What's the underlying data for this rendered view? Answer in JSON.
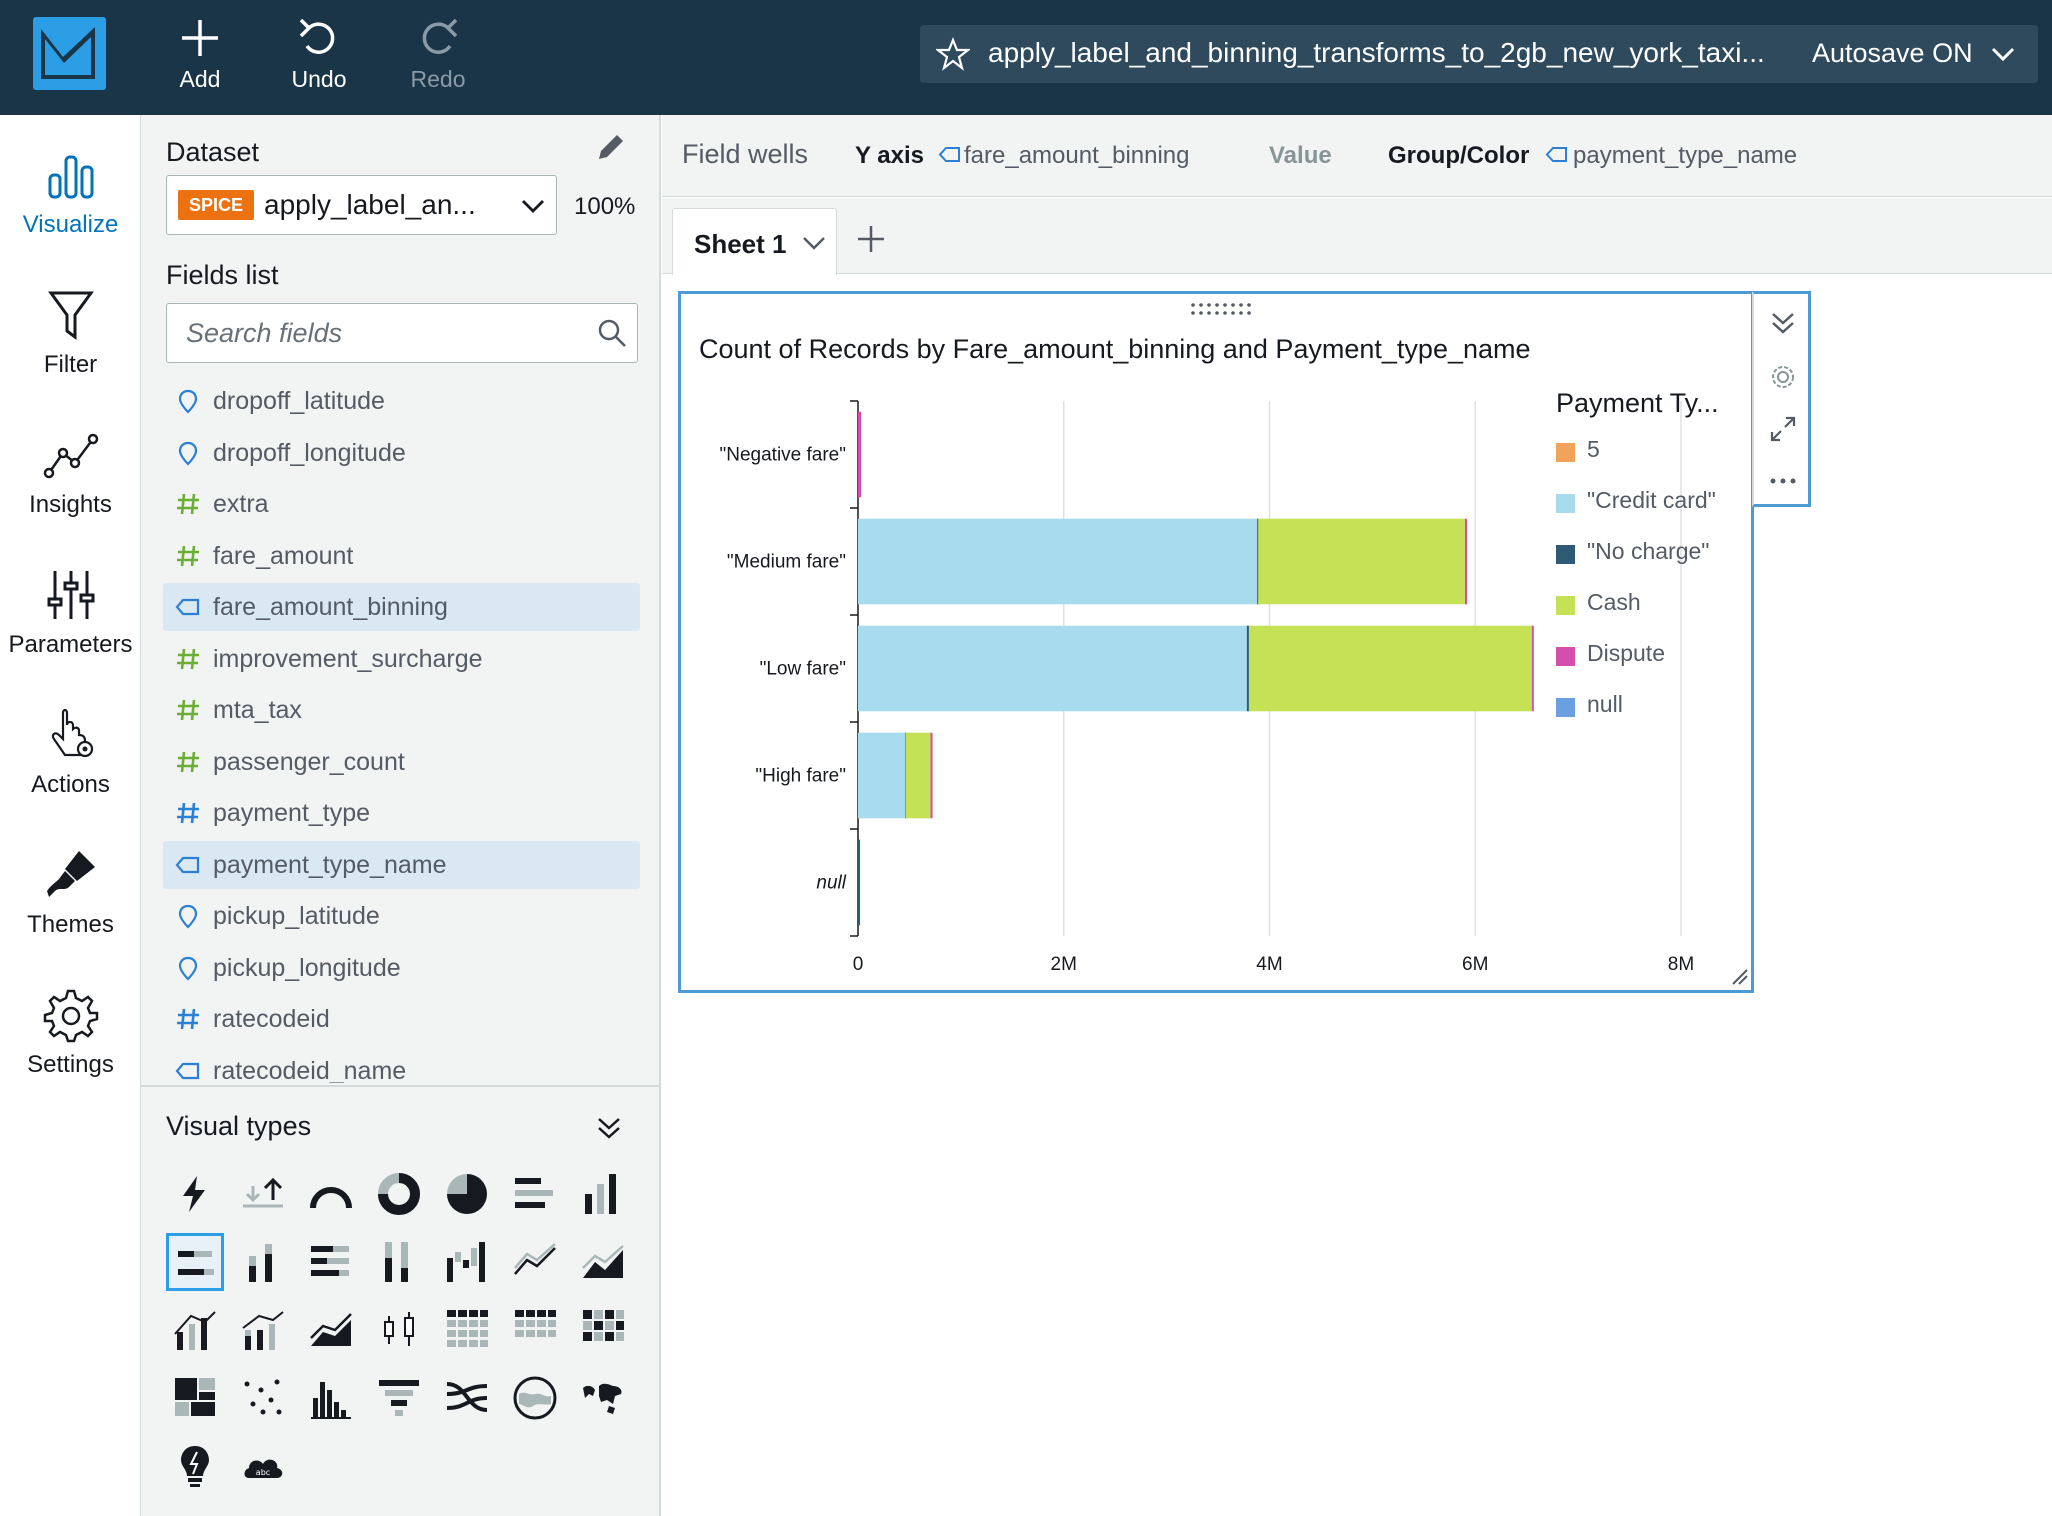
{
  "app": {
    "toolbar": {
      "add_label": "Add",
      "undo_label": "Undo",
      "redo_label": "Redo"
    },
    "analysis_title": "apply_label_and_binning_transforms_to_2gb_new_york_taxi...",
    "autosave_label": "Autosave ON"
  },
  "nav": {
    "items": [
      {
        "label": "Visualize",
        "icon": "bar-chart-icon",
        "active": true
      },
      {
        "label": "Filter",
        "icon": "funnel-icon"
      },
      {
        "label": "Insights",
        "icon": "insights-line-icon"
      },
      {
        "label": "Parameters",
        "icon": "sliders-icon"
      },
      {
        "label": "Actions",
        "icon": "pointer-gear-icon"
      },
      {
        "label": "Themes",
        "icon": "paintbrush-icon"
      },
      {
        "label": "Settings",
        "icon": "gear-icon"
      }
    ]
  },
  "data_panel": {
    "dataset_heading": "Dataset",
    "spice_badge": "SPICE",
    "dataset_name": "apply_label_an...",
    "dataset_percent": "100%",
    "fields_heading": "Fields list",
    "search_placeholder": "Search fields",
    "fields": [
      {
        "name": "dropoff_latitude",
        "type": "geo"
      },
      {
        "name": "dropoff_longitude",
        "type": "geo"
      },
      {
        "name": "extra",
        "type": "measure"
      },
      {
        "name": "fare_amount",
        "type": "measure"
      },
      {
        "name": "fare_amount_binning",
        "type": "dimension",
        "selected": true
      },
      {
        "name": "improvement_surcharge",
        "type": "measure"
      },
      {
        "name": "mta_tax",
        "type": "measure"
      },
      {
        "name": "passenger_count",
        "type": "measure"
      },
      {
        "name": "payment_type",
        "type": "measure-blue"
      },
      {
        "name": "payment_type_name",
        "type": "dimension",
        "selected": true
      },
      {
        "name": "pickup_latitude",
        "type": "geo"
      },
      {
        "name": "pickup_longitude",
        "type": "geo"
      },
      {
        "name": "ratecodeid",
        "type": "measure-blue"
      },
      {
        "name": "ratecodeid_name",
        "type": "dimension"
      }
    ],
    "visual_types_heading": "Visual types"
  },
  "field_wells": {
    "heading": "Field wells",
    "y_axis_label": "Y axis",
    "y_axis_field": "fare_amount_binning",
    "value_label": "Value",
    "group_label": "Group/Color",
    "group_field": "payment_type_name"
  },
  "sheet": {
    "name": "Sheet 1"
  },
  "visual": {
    "title": "Count of Records by Fare_amount_binning and Payment_type_name",
    "legend_title": "Payment Ty..."
  },
  "colors": {
    "accent": "#0073bb",
    "topbar": "#1a3547",
    "selection_border": "#4c9bd3"
  },
  "chart_data": {
    "type": "bar",
    "orientation": "horizontal",
    "stacked": true,
    "title": "Count of Records by Fare_amount_binning and Payment_type_name",
    "categories": [
      "\"Negative fare\"",
      "\"Medium fare\"",
      "\"Low fare\"",
      "\"High fare\"",
      "null"
    ],
    "x_ticks": [
      "0",
      "2M",
      "4M",
      "6M",
      "8M"
    ],
    "xlim": [
      0,
      8000000
    ],
    "legend_title": "Payment Ty...",
    "legend_position": "right",
    "series": [
      {
        "name": "5",
        "color": "#f0a35a",
        "values": [
          0,
          0,
          0,
          0,
          0
        ]
      },
      {
        "name": "\"Credit card\"",
        "color": "#a8dbee",
        "values": [
          0,
          3880000,
          3780000,
          460000,
          0
        ]
      },
      {
        "name": "\"No charge\"",
        "color": "#2e5a73",
        "values": [
          0,
          10000,
          20000,
          5000,
          20000
        ]
      },
      {
        "name": "Cash",
        "color": "#c5e155",
        "values": [
          0,
          2010000,
          2750000,
          240000,
          0
        ]
      },
      {
        "name": "Dispute",
        "color": "#d54eae",
        "values": [
          30000,
          20000,
          15000,
          20000,
          0
        ]
      },
      {
        "name": "null",
        "color": "#6a9fe0",
        "values": [
          0,
          0,
          0,
          0,
          0
        ]
      }
    ]
  }
}
